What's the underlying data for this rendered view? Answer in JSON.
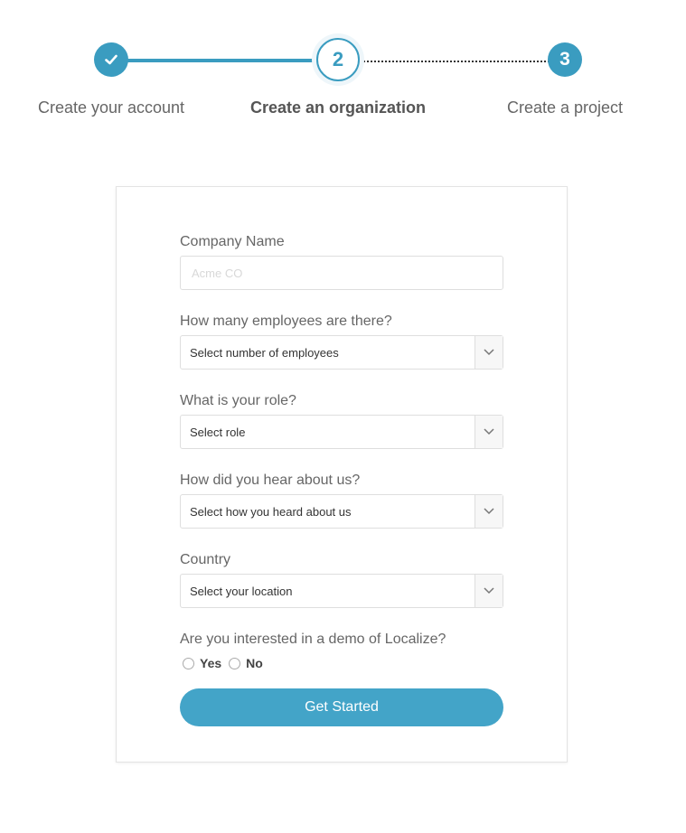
{
  "stepper": {
    "steps": [
      {
        "label": "Create your account",
        "state": "completed"
      },
      {
        "label": "Create an organization",
        "number": "2",
        "state": "active"
      },
      {
        "label": "Create a project",
        "number": "3",
        "state": "pending"
      }
    ]
  },
  "form": {
    "company_name": {
      "label": "Company Name",
      "placeholder": "Acme CO",
      "value": ""
    },
    "employees": {
      "label": "How many employees are there?",
      "selected": "Select number of employees"
    },
    "role": {
      "label": "What is your role?",
      "selected": "Select role"
    },
    "heard": {
      "label": "How did you hear about us?",
      "selected": "Select how you heard about us"
    },
    "country": {
      "label": "Country",
      "selected": "Select your location"
    },
    "demo": {
      "label": "Are you interested in a demo of Localize?",
      "options": [
        {
          "label": "Yes"
        },
        {
          "label": "No"
        }
      ]
    },
    "submit_label": "Get Started"
  },
  "colors": {
    "accent": "#3a9cc0",
    "button": "#43a4c8"
  },
  "icons": {
    "completed_step": "checkmark-icon",
    "select_arrow": "chevron-down-icon"
  }
}
